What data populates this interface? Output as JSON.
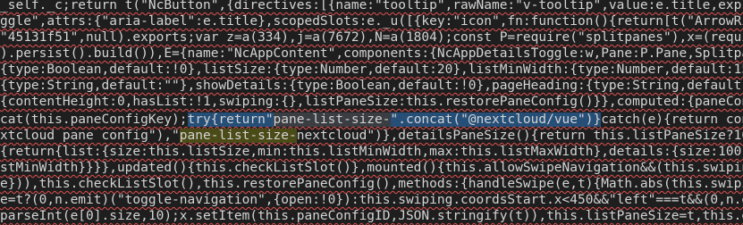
{
  "editor": {
    "lines": [
      {
        "segments": [
          {
            "text": "_self._c;return t(\"NcButton\",{directives:[{name:\"tooltip\",rawName:\"v-tooltip\",value:e.title,express"
          }
        ]
      },
      {
        "segments": [
          {
            "text": "ggle\",attrs:{\"aria-label\":e.title},scopedSlots:e._u([{key:\"icon\",fn:function(){return[t(\"ArrowRight"
          }
        ]
      },
      {
        "segments": [
          {
            "text": "\"45131f51\",null).exports;var z=a(334),j=a(7672),N=a(1804);const P=require(\"splitpanes\"),x=(require("
          }
        ]
      },
      {
        "segments": [
          {
            "text": ").persist().build()),E={name:\"NcAppContent\",components:{NcAppDetailsToggle:w,Pane:P.Pane,Splitpanes"
          }
        ]
      },
      {
        "segments": [
          {
            "text": "{type:Boolean,default:!0},listSize:{type:Number,default:20},listMinWidth:{type:Number,default:15},"
          }
        ]
      },
      {
        "segments": [
          {
            "text": "{type:String,default:\"\"},showDetails:{type:Boolean,default:!0},pageHeading:{type:String,default:null"
          }
        ]
      },
      {
        "segments": [
          {
            "text": "{contentHeight:0,hasList:!1,swiping:{},listPaneSize:this.restorePaneConfig()}},computed:{paneConfi"
          }
        ]
      },
      {
        "segments": [
          {
            "text": "cat(this.paneConfigKey);",
            "cls": ""
          },
          {
            "text": "try{return\"",
            "cls": "hl"
          },
          {
            "text": "pane-list-size-",
            "cls": "hl-soft"
          },
          {
            "text": "\".concat(\"@nextcloud/vue\")}",
            "cls": "hl"
          },
          {
            "text": "catch(e){return console",
            "cls": ""
          }
        ]
      },
      {
        "segments": [
          {
            "text": "xtcloud pane config\"),\"",
            "cls": ""
          },
          {
            "text": "pane-list-size-",
            "cls": "word-hl"
          },
          {
            "text": "nextcloud\")},detailsPaneSize(){return this.listPaneSize?100-th",
            "cls": ""
          }
        ]
      },
      {
        "segments": [
          {
            "text": "{return{list:{size:this.listSize,min:this.listMinWidth,max:this.listMaxWidth},details:{size:100-th"
          }
        ]
      },
      {
        "segments": [
          {
            "text": "stMinWidth}}}},updated(){this.checkListSlot()},mounted(){this.allowSwipeNavigation&&(this.swiping="
          }
        ]
      },
      {
        "segments": [
          {
            "text": "e})),this.checkListSlot(),this.restorePaneConfig(),methods:{handleSwipe(e,t){Math.abs(this.swiping"
          }
        ]
      },
      {
        "segments": [
          {
            "text": "e=t?(0,n.emit)(\"toggle-navigation\",{open:!0}):this.swiping.coordsStart.x<450&&\"left\"===t&&(0,n.emit"
          }
        ]
      },
      {
        "segments": [
          {
            "text": "parseInt(e[0].size,10);x.setItem(this.paneConfigID,JSON.stringify(t)),this.listPaneSize=t,this.emit"
          }
        ]
      }
    ]
  }
}
